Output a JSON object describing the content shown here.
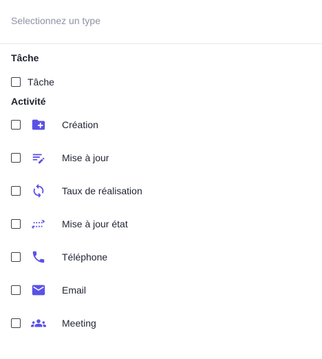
{
  "search": {
    "placeholder": "Selectionnez un type"
  },
  "groups": [
    {
      "title": "Tâche",
      "items": [
        {
          "label": "Tâche"
        }
      ]
    },
    {
      "title": "Activité",
      "items": [
        {
          "label": "Création",
          "icon": "folder-plus-icon"
        },
        {
          "label": "Mise à jour",
          "icon": "edit-list-icon"
        },
        {
          "label": "Taux de réalisation",
          "icon": "sync-icon"
        },
        {
          "label": "Mise à jour état",
          "icon": "swap-arrows-icon"
        },
        {
          "label": "Téléphone",
          "icon": "phone-icon"
        },
        {
          "label": "Email",
          "icon": "mail-icon"
        },
        {
          "label": "Meeting",
          "icon": "people-icon"
        }
      ]
    }
  ],
  "colors": {
    "accent": "#5b52e6",
    "divider": "#e6e8ee",
    "placeholder": "#8d93a3"
  }
}
